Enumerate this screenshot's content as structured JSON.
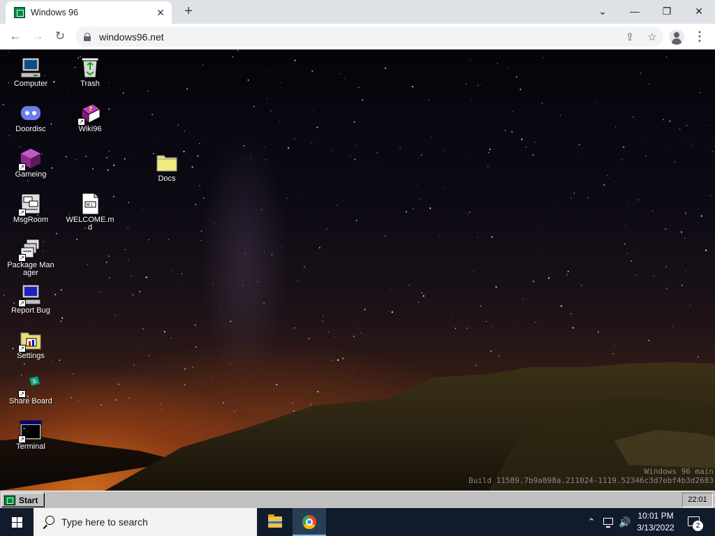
{
  "browser": {
    "tab_title": "Windows 96",
    "tab_close": "✕",
    "new_tab": "+",
    "url": "windows96.net",
    "window_controls": {
      "tab_search": "⌄",
      "minimize": "—",
      "restore": "❐",
      "close": "✕"
    },
    "nav": {
      "back": "←",
      "forward": "→",
      "reload": "↻"
    },
    "omnibox_icons": {
      "share": "⇪",
      "star": "☆"
    },
    "menu": "⋮"
  },
  "desktop": {
    "icons": {
      "computer": "Computer",
      "trash": "Trash",
      "doordisc": "Doordisc",
      "wiki96": "Wiki96",
      "gameing": "Gameing",
      "docs": "Docs",
      "msgroom": "MsgRoom",
      "welcome": "WELCOME.md",
      "package_manager": "Package Manager",
      "report_bug": "Report Bug",
      "settings": "Settings",
      "share_board": "Share Board",
      "terminal": "Terminal"
    },
    "watermark": {
      "line1": "Windows 96 main",
      "line2": "Build 11589.7b9a898a.211024-1119.52346c3d7ebf4b3d2683"
    }
  },
  "win96_taskbar": {
    "start_label": "Start",
    "clock": "22:01"
  },
  "win10_taskbar": {
    "search_placeholder": "Type here to search",
    "tray_chevron": "⌃",
    "volume": "🔊",
    "time": "10:01 PM",
    "date": "3/13/2022",
    "notification_count": "2"
  },
  "colors": {
    "win10_taskbar_bg": "#101b2c",
    "win96_gray": "#c0c0c0",
    "chrome_tabstrip": "#dee1e6"
  }
}
